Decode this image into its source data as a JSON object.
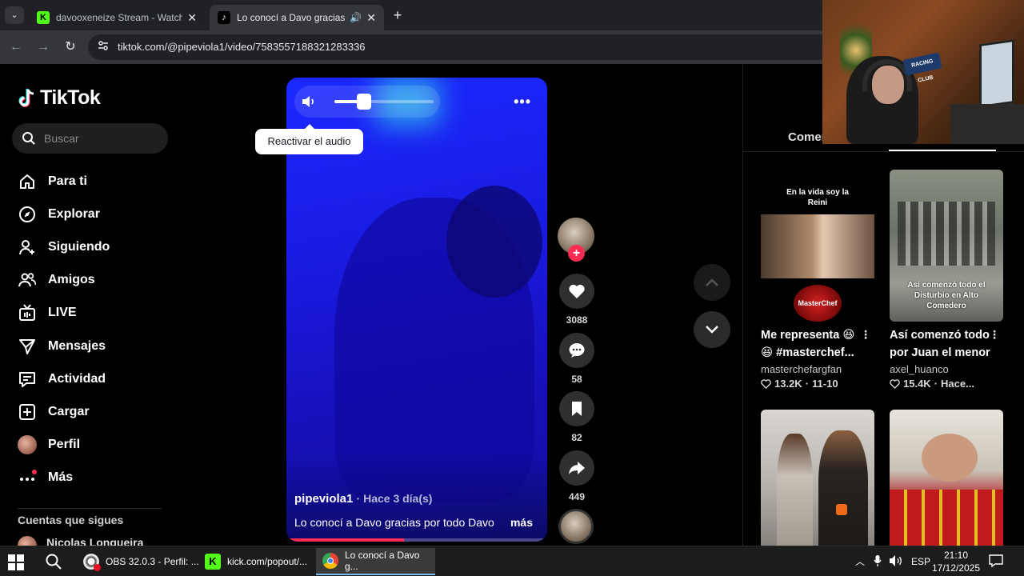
{
  "browser": {
    "tabs": [
      {
        "title": "davooxeneize Stream - Watch L",
        "active": false,
        "favicon": "kick-logo"
      },
      {
        "title": "Lo conocí a Davo gracias po",
        "active": true,
        "favicon": "tiktok-logo",
        "audio": true
      }
    ],
    "url": "tiktok.com/@pipeviola1/video/7583557188321283336"
  },
  "tiktok": {
    "logo_text": "TikTok",
    "search_placeholder": "Buscar",
    "nav": [
      {
        "label": "Para ti",
        "icon": "home-icon"
      },
      {
        "label": "Explorar",
        "icon": "compass-icon"
      },
      {
        "label": "Siguiendo",
        "icon": "user-plus-icon"
      },
      {
        "label": "Amigos",
        "icon": "friends-icon"
      },
      {
        "label": "LIVE",
        "icon": "live-icon"
      },
      {
        "label": "Mensajes",
        "icon": "message-icon"
      },
      {
        "label": "Actividad",
        "icon": "activity-icon"
      },
      {
        "label": "Cargar",
        "icon": "upload-icon"
      },
      {
        "label": "Perfil",
        "icon": "profile-avatar"
      },
      {
        "label": "Más",
        "icon": "more-icon"
      }
    ],
    "following_title": "Cuentas que sigues",
    "following_first": "Nicolas Longueira"
  },
  "video": {
    "tooltip": "Reactivar el audio",
    "author": "pipeviola1",
    "time": "· Hace 3 día(s)",
    "caption": "Lo conocí a Davo gracias por todo Davo",
    "more": "más",
    "volume_level": 0.3,
    "progress": 0.45,
    "actions": {
      "likes": "3088",
      "comments": "58",
      "saves": "82",
      "shares": "449"
    }
  },
  "panel": {
    "tab_label": "Comen",
    "recommendations": [
      {
        "title": "Me representa 😆 😆 #masterchef...",
        "author": "masterchefargfan",
        "likes": "13.2K",
        "date": "11-10",
        "thumb_text": "En la vida soy la Reini",
        "thumb_logo": "MasterChef"
      },
      {
        "title": "Así comenzó todo por Juan el menor",
        "author": "axel_huanco",
        "likes": "15.4K",
        "date": "Hace...",
        "thumb_text": "Así comenzó todo el Disturbio en Alto Comedero"
      },
      {
        "title": "",
        "author": "",
        "likes": "",
        "date": ""
      },
      {
        "title": "",
        "author": "",
        "likes": "",
        "date": ""
      }
    ]
  },
  "webcam": {
    "sign_text": "RACING CLUB"
  },
  "taskbar": {
    "apps": [
      {
        "label": "OBS 32.0.3 - Perfil: ...",
        "icon": "obs-icon"
      },
      {
        "label": "kick.com/popout/...",
        "icon": "kick-icon"
      },
      {
        "label": "Lo conocí a Davo g...",
        "icon": "chrome-icon",
        "active": true
      }
    ],
    "language": "ESP",
    "time": "21:10",
    "date": "17/12/2025"
  }
}
